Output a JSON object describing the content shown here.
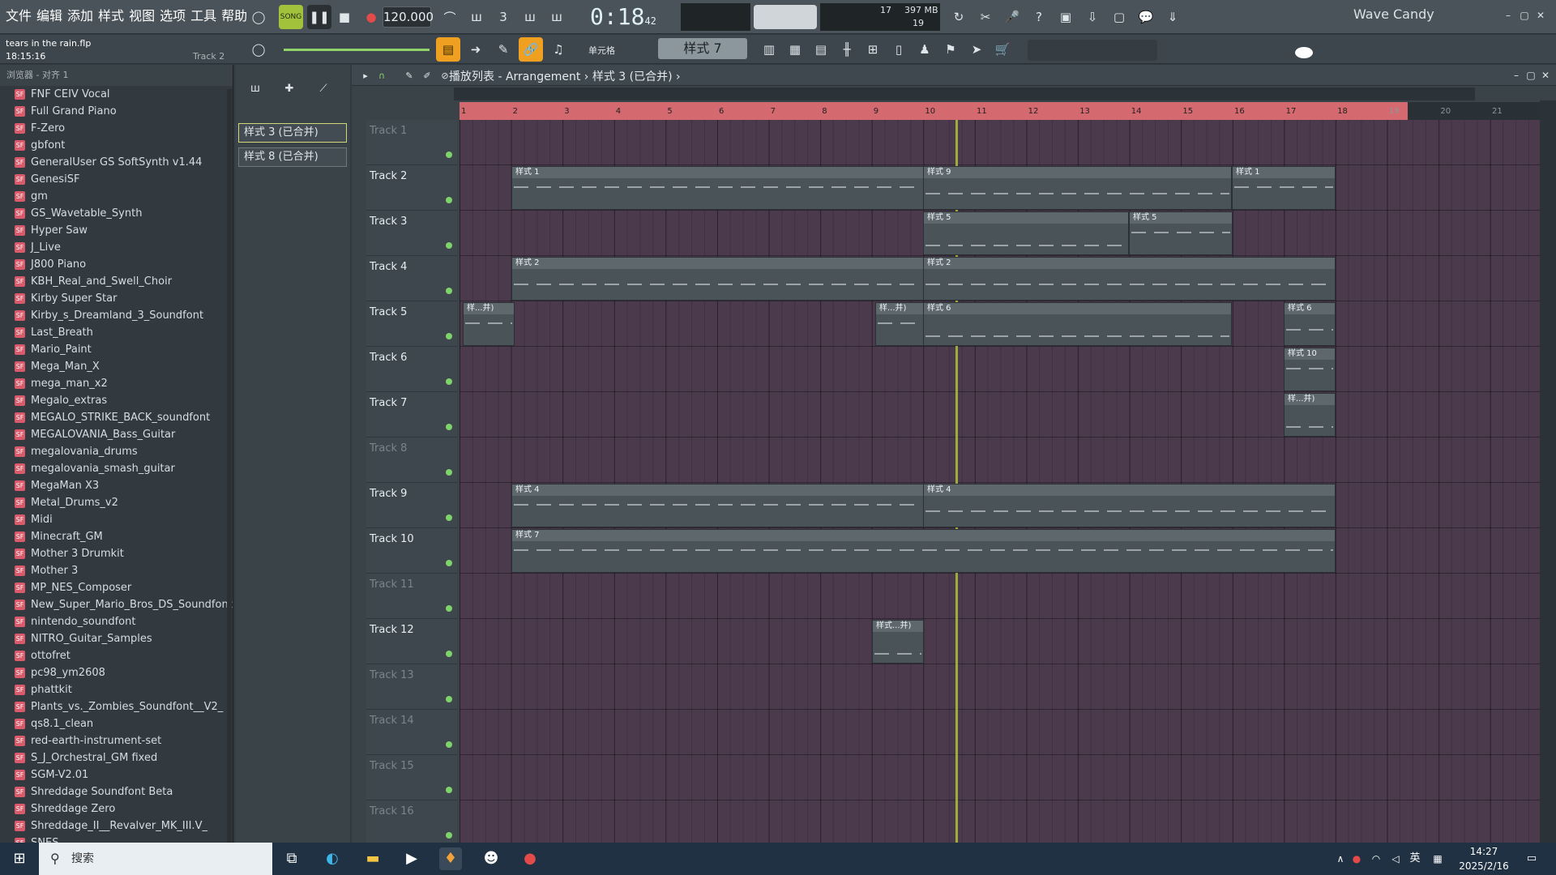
{
  "menu": [
    "文件",
    "编辑",
    "添加",
    "样式",
    "视图",
    "选项",
    "工具",
    "帮助"
  ],
  "transport": {
    "song_label": "SONG",
    "tempo": "120.000",
    "time": "0:18",
    "time_small": "42",
    "time_unit": "M:S:CS"
  },
  "cpu": {
    "value1": "17",
    "memory": "397 MB",
    "value2": "19"
  },
  "brand": "Wave Candy",
  "project": {
    "file": "tears in the rain.flp",
    "time": "18:15:16",
    "track": "Track 2"
  },
  "snap_label": "单元格",
  "pattern_selector": "样式 7",
  "browser": {
    "header": "浏览器 - 对齐 1",
    "items": [
      "FNF CEIV Vocal",
      "Full Grand Piano",
      "F-Zero",
      "gbfont",
      "GeneralUser GS SoftSynth v1.44",
      "GenesiSF",
      "gm",
      "GS_Wavetable_Synth",
      "Hyper Saw",
      "J_Live",
      "J800 Piano",
      "KBH_Real_and_Swell_Choir",
      "Kirby Super Star",
      "Kirby_s_Dreamland_3_Soundfont",
      "Last_Breath",
      "Mario_Paint",
      "Mega_Man_X",
      "mega_man_x2",
      "Megalo_extras",
      "MEGALO_STRIKE_BACK_soundfont",
      "MEGALOVANIA_Bass_Guitar",
      "megalovania_drums",
      "megalovania_smash_guitar",
      "MegaMan X3",
      "Metal_Drums_v2",
      "Midi",
      "Minecraft_GM",
      "Mother 3 Drumkit",
      "Mother 3",
      "MP_NES_Composer",
      "New_Super_Mario_Bros_DS_Soundfont",
      "nintendo_soundfont",
      "NITRO_Guitar_Samples",
      "ottofret",
      "pc98_ym2608",
      "phattkit",
      "Plants_vs._Zombies_Soundfont__V2_",
      "qs8.1_clean",
      "red-earth-instrument-set",
      "S_J_Orchestral_GM fixed",
      "SGM-V2.01",
      "Shreddage Soundfont Beta",
      "Shreddage Zero",
      "Shreddage_II__Revalver_MK_III.V_",
      "SNES"
    ]
  },
  "picker": [
    "样式 3 (已合并)",
    "样式 8 (已合并)"
  ],
  "playlist": {
    "title": "播放列表 - Arrangement › 样式 3 (已合并) ›",
    "bars": [
      "1",
      "2",
      "3",
      "4",
      "5",
      "6",
      "7",
      "8",
      "9",
      "10",
      "11",
      "12",
      "13",
      "14",
      "15",
      "16",
      "17",
      "18",
      "19",
      "20",
      "21"
    ],
    "tracks": [
      "Track 1",
      "Track 2",
      "Track 3",
      "Track 4",
      "Track 5",
      "Track 6",
      "Track 7",
      "Track 8",
      "Track 9",
      "Track 10",
      "Track 11",
      "Track 12",
      "Track 13",
      "Track 14",
      "Track 15",
      "Track 16"
    ],
    "clips": [
      {
        "label": "样式 1"
      },
      {
        "label": "样式 9"
      },
      {
        "label": "样式 1"
      },
      {
        "label": "样式 5"
      },
      {
        "label": "样式 5"
      },
      {
        "label": "样式 2"
      },
      {
        "label": "样式 2"
      },
      {
        "label": "样...并)"
      },
      {
        "label": "样...并)"
      },
      {
        "label": "样式 6"
      },
      {
        "label": "样式 6"
      },
      {
        "label": "样式 10"
      },
      {
        "label": "样...并)"
      },
      {
        "label": "样式 4"
      },
      {
        "label": "样式 4"
      },
      {
        "label": "样式 7"
      },
      {
        "label": "样式...并)"
      }
    ]
  },
  "taskbar": {
    "search": "搜索",
    "time": "14:27",
    "date": "2025/2/16",
    "ime": "英"
  }
}
